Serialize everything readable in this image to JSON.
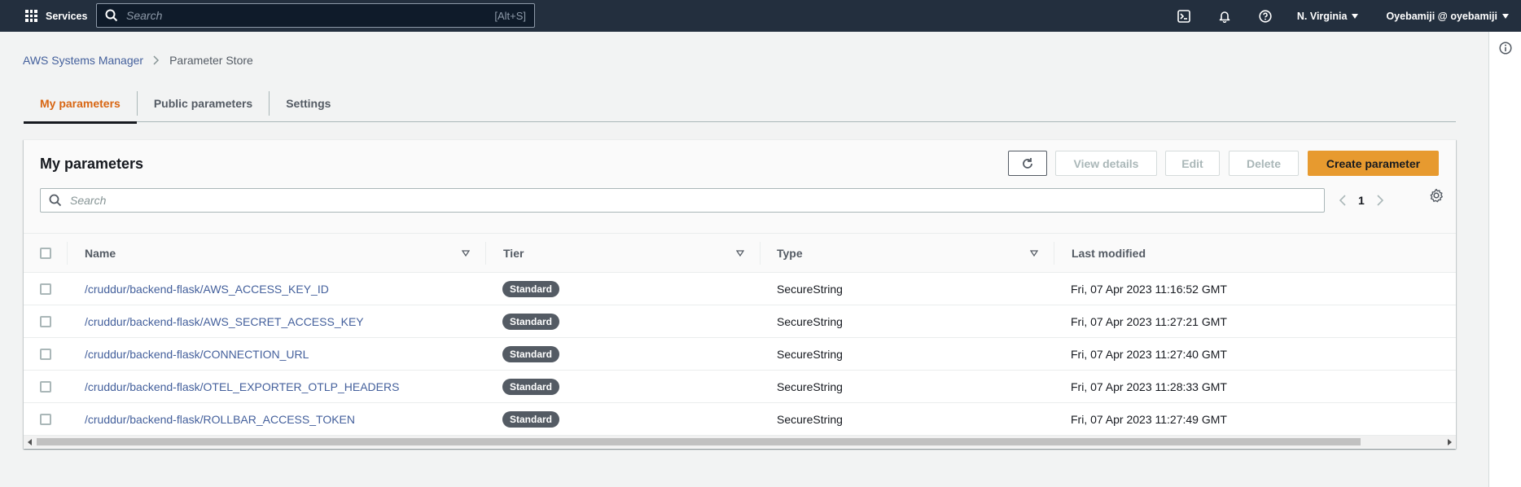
{
  "topnav": {
    "services_label": "Services",
    "search_placeholder": "Search",
    "search_shortcut": "[Alt+S]",
    "region": "N. Virginia",
    "user": "Oyebamiji @ oyebamiji",
    "icons": [
      "cloudshell-icon",
      "notifications-bell-icon",
      "help-icon"
    ]
  },
  "breadcrumb": {
    "parent": "AWS Systems Manager",
    "current": "Parameter Store"
  },
  "tabs": [
    {
      "label": "My parameters",
      "active": true
    },
    {
      "label": "Public parameters",
      "active": false
    },
    {
      "label": "Settings",
      "active": false
    }
  ],
  "panel": {
    "title": "My parameters",
    "buttons": {
      "view_details": "View details",
      "edit": "Edit",
      "delete": "Delete",
      "create": "Create parameter"
    },
    "search_placeholder": "Search",
    "page": "1"
  },
  "table": {
    "columns": [
      "Name",
      "Tier",
      "Type",
      "Last modified"
    ],
    "rows": [
      {
        "name": "/cruddur/backend-flask/AWS_ACCESS_KEY_ID",
        "tier": "Standard",
        "type": "SecureString",
        "modified": "Fri, 07 Apr 2023 11:16:52 GMT"
      },
      {
        "name": "/cruddur/backend-flask/AWS_SECRET_ACCESS_KEY",
        "tier": "Standard",
        "type": "SecureString",
        "modified": "Fri, 07 Apr 2023 11:27:21 GMT"
      },
      {
        "name": "/cruddur/backend-flask/CONNECTION_URL",
        "tier": "Standard",
        "type": "SecureString",
        "modified": "Fri, 07 Apr 2023 11:27:40 GMT"
      },
      {
        "name": "/cruddur/backend-flask/OTEL_EXPORTER_OTLP_HEADERS",
        "tier": "Standard",
        "type": "SecureString",
        "modified": "Fri, 07 Apr 2023 11:28:33 GMT"
      },
      {
        "name": "/cruddur/backend-flask/ROLLBAR_ACCESS_TOKEN",
        "tier": "Standard",
        "type": "SecureString",
        "modified": "Fri, 07 Apr 2023 11:27:49 GMT"
      }
    ]
  },
  "colors": {
    "nav_bg": "#232f3e",
    "accent_orange": "#e79a2f",
    "active_tab": "#d86613",
    "link": "#44609c"
  }
}
